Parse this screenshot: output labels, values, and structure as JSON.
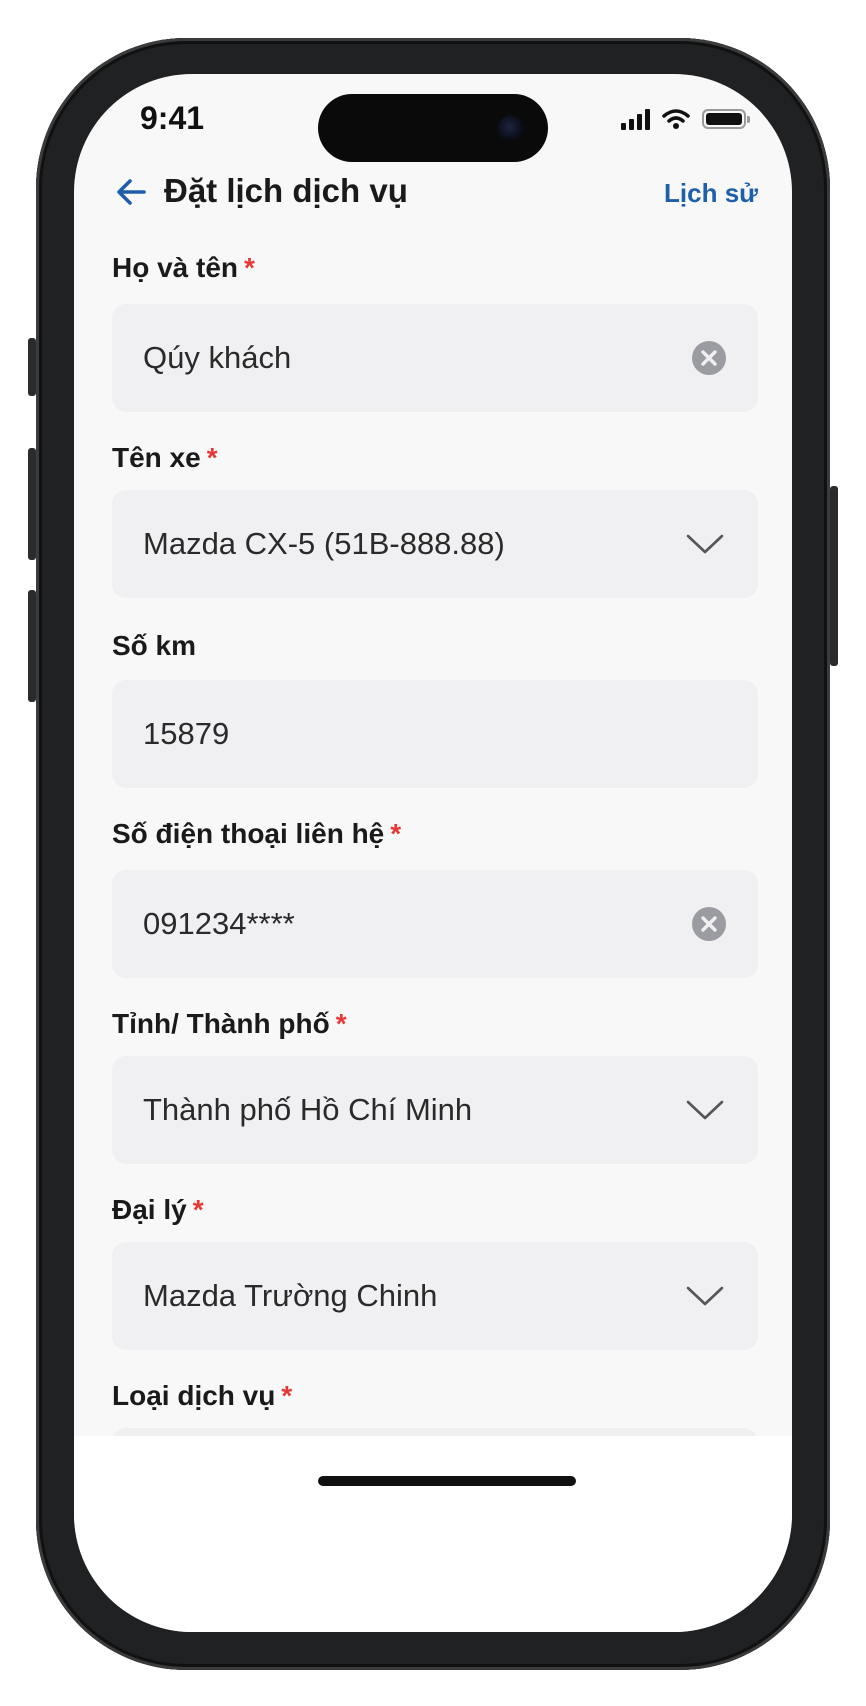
{
  "status": {
    "time": "9:41"
  },
  "header": {
    "title": "Đặt lịch dịch vụ",
    "history_label": "Lịch sử"
  },
  "colors": {
    "accent": "#1d5fa8",
    "required": "#e53935",
    "field_bg": "#f0f0f2"
  },
  "fields": [
    {
      "label": "Họ và tên",
      "required": "*",
      "value": "Qúy khách",
      "control": "clear"
    },
    {
      "label": "Tên xe",
      "required": "*",
      "value": "Mazda CX-5 (51B-888.88)",
      "control": "dropdown"
    },
    {
      "label": "Số km",
      "required": "",
      "value": "15879",
      "control": "none"
    },
    {
      "label": "Số điện thoại liên hệ",
      "required": "*",
      "value": "091234****",
      "control": "clear"
    },
    {
      "label": "Tỉnh/ Thành phố",
      "required": "*",
      "value": "Thành phố Hồ Chí Minh",
      "control": "dropdown"
    },
    {
      "label": "Đại lý",
      "required": "*",
      "value": "Mazda Trường Chinh",
      "control": "dropdown"
    },
    {
      "label": "Loại dịch vụ",
      "required": "*",
      "value": "",
      "control": "dropdown"
    }
  ]
}
